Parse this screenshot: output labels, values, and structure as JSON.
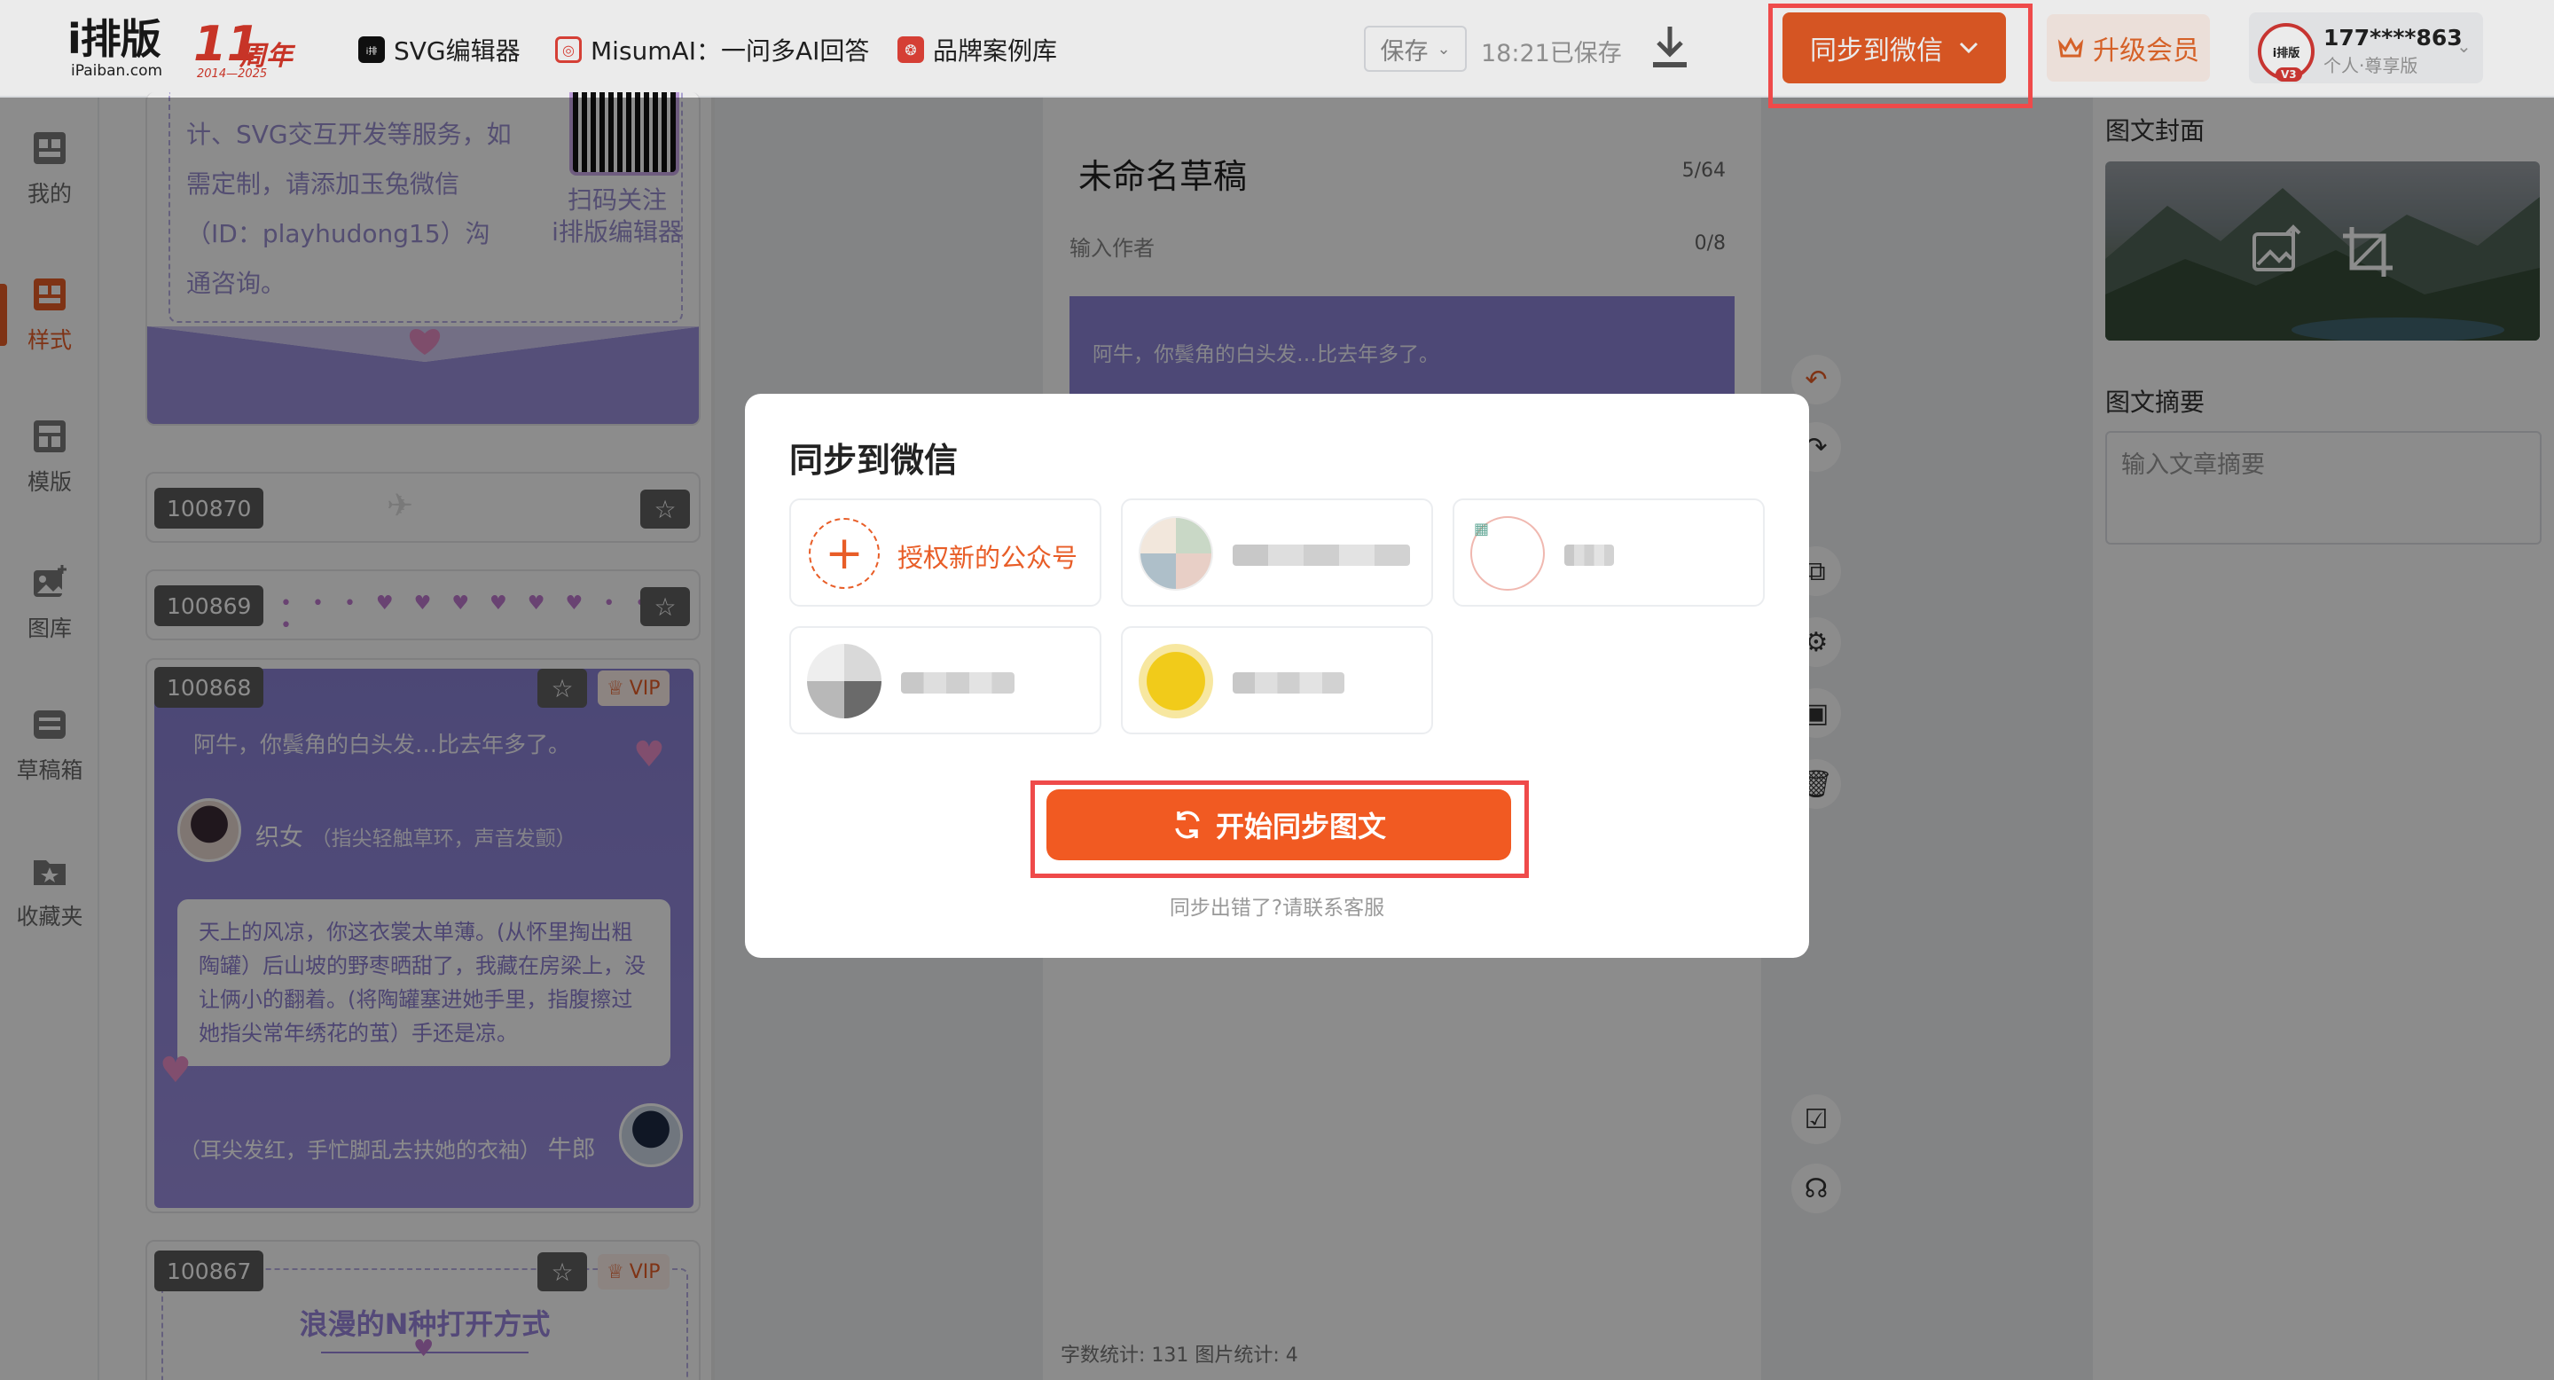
{
  "header": {
    "logo_main": "i排版",
    "logo_sub": "iPaiban.com",
    "anniversary": {
      "num": "11",
      "text": "周年",
      "years": "2014—2025"
    },
    "nav": [
      {
        "label": "SVG编辑器",
        "icon": "svg-editor-icon",
        "color": "#111111"
      },
      {
        "label": "MisumAI：一问多AI回答",
        "icon": "ai-icon",
        "color": "#e8453a"
      },
      {
        "label": "品牌案例库",
        "icon": "case-library-icon",
        "color": "#e8453a"
      }
    ],
    "save_dropdown": "保存",
    "save_status": "18:21已保存",
    "sync_button": "同步到微信",
    "upgrade_button": "升级会员",
    "user": {
      "phone": "177****863",
      "plan": "个人·尊享版",
      "badge": "V3",
      "avatar_text": "i排版"
    }
  },
  "rail": [
    {
      "label": "我的",
      "icon": "my-icon"
    },
    {
      "label": "样式",
      "icon": "style-icon",
      "active": true
    },
    {
      "label": "模版",
      "icon": "template-icon"
    },
    {
      "label": "图库",
      "icon": "gallery-icon"
    },
    {
      "label": "草稿箱",
      "icon": "drafts-icon"
    },
    {
      "label": "收藏夹",
      "icon": "favorites-icon"
    }
  ],
  "styles": {
    "card1": {
      "text": "计、SVG交互开发等服务，如需定制，请添加玉兔微信（ID：playhudong15）沟通咨询。",
      "scan_line1": "扫码关注",
      "scan_line2": "i排版编辑器"
    },
    "card2": {
      "id": "100870"
    },
    "card3": {
      "id": "100869"
    },
    "card4": {
      "id": "100868",
      "vip": "VIP",
      "quote": "阿牛，你鬓角的白头发…比去年多了。",
      "name1": "织女",
      "name1_note": "（指尖轻触草环，声音发颤）",
      "bubble": "天上的风凉，你这衣裳太单薄。(从怀里掏出粗陶罐）后山坡的野枣晒甜了，我藏在房梁上，没让俩小的翻着。(将陶罐塞进她手里，指腹擦过她指尖常年绣花的茧）手还是凉。",
      "line2": "（耳尖发红，手忙脚乱去扶她的衣袖）",
      "name2": "牛郎"
    },
    "card5": {
      "id": "100867",
      "vip": "VIP",
      "title": "浪漫的N种打开方式"
    }
  },
  "editor": {
    "title": "未命名草稿",
    "title_count": "5/64",
    "author_placeholder": "输入作者",
    "author_count": "0/8",
    "preview_text": "阿牛，你鬓角的白头发…比去年多了。",
    "stats": "字数统计: 131    图片统计: 4"
  },
  "right_panel": {
    "cover_label": "图文封面",
    "summary_label": "图文摘要",
    "summary_placeholder": "输入文章摘要"
  },
  "modal": {
    "title": "同步到微信",
    "add_account": "授权新的公众号",
    "start_button": "开始同步图文",
    "error_link": "同步出错了?请联系客服"
  },
  "colors": {
    "accent": "#e85d27",
    "highlight": "#ef4a4a",
    "style_purple": "#8a82d6"
  }
}
